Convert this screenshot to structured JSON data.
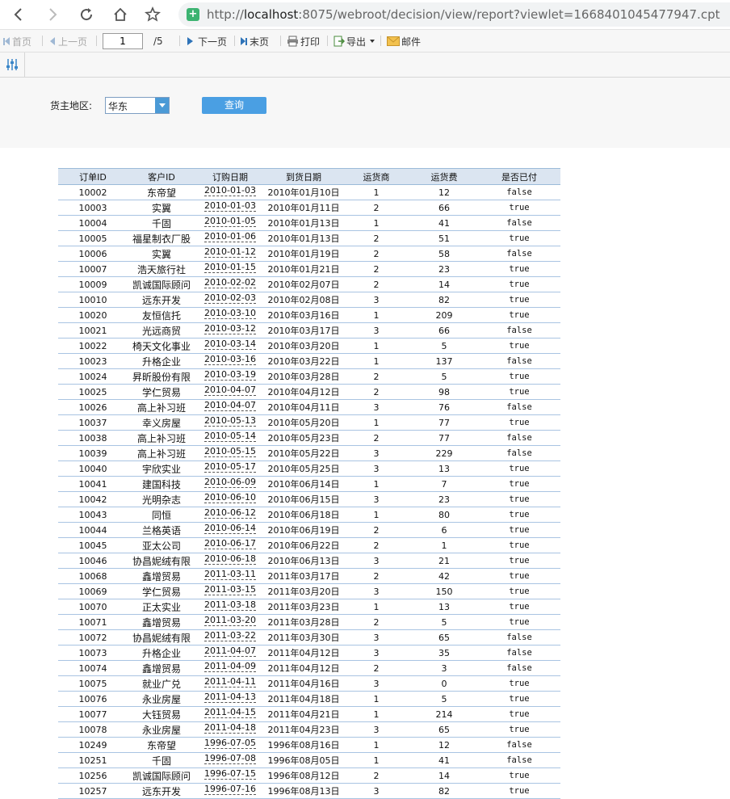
{
  "browser": {
    "url_host": "localhost",
    "url_rest": ":8075/webroot/decision/view/report?viewlet=1668401045477947.cpt",
    "url_prefix": "http://"
  },
  "toolbar": {
    "first": "首页",
    "prev": "上一页",
    "page_input": "1",
    "page_total": "/5",
    "next": "下一页",
    "last": "末页",
    "print": "打印",
    "export": "导出",
    "mail": "邮件"
  },
  "params": {
    "region_label": "货主地区:",
    "region_value": "华东",
    "query_button": "查询"
  },
  "table": {
    "headers": [
      "订单ID",
      "客户ID",
      "订购日期",
      "到货日期",
      "运货商",
      "运货费",
      "是否已付"
    ],
    "rows": [
      [
        "10002",
        "东帝望",
        "2010-01-03",
        "2010年01月10日",
        "1",
        "12",
        "false"
      ],
      [
        "10003",
        "实翼",
        "2010-01-03",
        "2010年01月11日",
        "2",
        "66",
        "true"
      ],
      [
        "10004",
        "千固",
        "2010-01-05",
        "2010年01月13日",
        "1",
        "41",
        "false"
      ],
      [
        "10005",
        "福星制衣厂股",
        "2010-01-06",
        "2010年01月13日",
        "2",
        "51",
        "true"
      ],
      [
        "10006",
        "实翼",
        "2010-01-12",
        "2010年01月19日",
        "2",
        "58",
        "false"
      ],
      [
        "10007",
        "浩天旅行社",
        "2010-01-15",
        "2010年01月21日",
        "2",
        "23",
        "true"
      ],
      [
        "10009",
        "凯诚国际顾问",
        "2010-02-02",
        "2010年02月07日",
        "2",
        "14",
        "true"
      ],
      [
        "10010",
        "远东开发",
        "2010-02-03",
        "2010年02月08日",
        "3",
        "82",
        "true"
      ],
      [
        "10020",
        "友恒信托",
        "2010-03-10",
        "2010年03月16日",
        "1",
        "209",
        "true"
      ],
      [
        "10021",
        "光远商贸",
        "2010-03-12",
        "2010年03月17日",
        "3",
        "66",
        "false"
      ],
      [
        "10022",
        "椅天文化事业",
        "2010-03-14",
        "2010年03月20日",
        "1",
        "5",
        "true"
      ],
      [
        "10023",
        "升格企业",
        "2010-03-16",
        "2010年03月22日",
        "1",
        "137",
        "false"
      ],
      [
        "10024",
        "昇昕股份有限",
        "2010-03-19",
        "2010年03月28日",
        "2",
        "5",
        "true"
      ],
      [
        "10025",
        "学仁贸易",
        "2010-04-07",
        "2010年04月12日",
        "2",
        "98",
        "true"
      ],
      [
        "10026",
        "高上补习班",
        "2010-04-07",
        "2010年04月11日",
        "3",
        "76",
        "false"
      ],
      [
        "10037",
        "幸义房屋",
        "2010-05-13",
        "2010年05月20日",
        "1",
        "77",
        "true"
      ],
      [
        "10038",
        "高上补习班",
        "2010-05-14",
        "2010年05月23日",
        "2",
        "77",
        "false"
      ],
      [
        "10039",
        "高上补习班",
        "2010-05-15",
        "2010年05月22日",
        "3",
        "229",
        "false"
      ],
      [
        "10040",
        "宇欣实业",
        "2010-05-17",
        "2010年05月25日",
        "3",
        "13",
        "true"
      ],
      [
        "10041",
        "建国科技",
        "2010-06-09",
        "2010年06月14日",
        "1",
        "7",
        "true"
      ],
      [
        "10042",
        "光明杂志",
        "2010-06-10",
        "2010年06月15日",
        "3",
        "23",
        "true"
      ],
      [
        "10043",
        "同恒",
        "2010-06-12",
        "2010年06月18日",
        "1",
        "80",
        "true"
      ],
      [
        "10044",
        "兰格英语",
        "2010-06-14",
        "2010年06月19日",
        "2",
        "6",
        "true"
      ],
      [
        "10045",
        "亚太公司",
        "2010-06-17",
        "2010年06月22日",
        "2",
        "1",
        "true"
      ],
      [
        "10046",
        "协昌妮绒有限",
        "2010-06-18",
        "2010年06月13日",
        "3",
        "21",
        "true"
      ],
      [
        "10068",
        "鑫增贸易",
        "2011-03-11",
        "2011年03月17日",
        "2",
        "42",
        "true"
      ],
      [
        "10069",
        "学仁贸易",
        "2011-03-15",
        "2011年03月20日",
        "3",
        "150",
        "true"
      ],
      [
        "10070",
        "正太实业",
        "2011-03-18",
        "2011年03月23日",
        "1",
        "13",
        "true"
      ],
      [
        "10071",
        "鑫增贸易",
        "2011-03-20",
        "2011年03月28日",
        "2",
        "5",
        "true"
      ],
      [
        "10072",
        "协昌妮绒有限",
        "2011-03-22",
        "2011年03月30日",
        "3",
        "65",
        "false"
      ],
      [
        "10073",
        "升格企业",
        "2011-04-07",
        "2011年04月12日",
        "3",
        "35",
        "false"
      ],
      [
        "10074",
        "鑫增贸易",
        "2011-04-09",
        "2011年04月12日",
        "2",
        "3",
        "false"
      ],
      [
        "10075",
        "就业广兑",
        "2011-04-11",
        "2011年04月16日",
        "3",
        "0",
        "true"
      ],
      [
        "10076",
        "永业房屋",
        "2011-04-13",
        "2011年04月18日",
        "1",
        "5",
        "true"
      ],
      [
        "10077",
        "大钰贸易",
        "2011-04-15",
        "2011年04月21日",
        "1",
        "214",
        "true"
      ],
      [
        "10078",
        "永业房屋",
        "2011-04-18",
        "2011年04月23日",
        "3",
        "65",
        "true"
      ],
      [
        "10249",
        "东帝望",
        "1996-07-05",
        "1996年08月16日",
        "1",
        "12",
        "false"
      ],
      [
        "10251",
        "千固",
        "1996-07-08",
        "1996年08月05日",
        "1",
        "41",
        "false"
      ],
      [
        "10256",
        "凯诚国际顾问",
        "1996-07-15",
        "1996年08月12日",
        "2",
        "14",
        "true"
      ],
      [
        "10257",
        "远东开发",
        "1996-07-16",
        "1996年08月13日",
        "3",
        "82",
        "true"
      ]
    ]
  }
}
